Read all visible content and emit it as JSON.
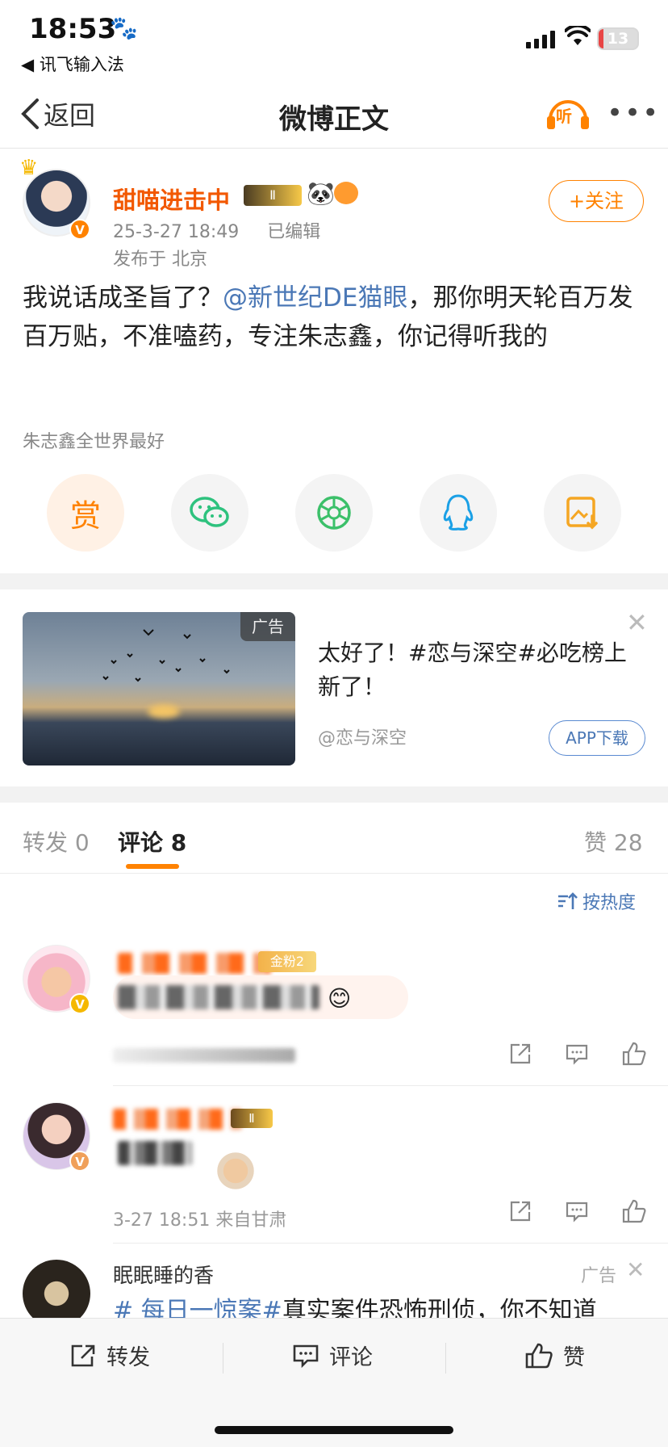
{
  "status_bar": {
    "time": "18:53",
    "back_app": "◀ 讯飞输入法",
    "battery_level": "13"
  },
  "nav": {
    "back_label": "返回",
    "title": "微博正文",
    "listen_label": "听"
  },
  "post": {
    "username": "甜喵进击中",
    "level_badge": "Ⅱ",
    "datetime": "25-3-27 18:49",
    "edited": "已编辑",
    "location": "发布于 北京",
    "follow_label": "+关注",
    "content_prefix": "我说话成圣旨了？",
    "mention": "@新世纪DE猫眼",
    "content_suffix": "，那你明天轮百万发百万贴，不准嗑药，专注朱志鑫，你记得听我的",
    "topic": "朱志鑫全世界最好",
    "share_buttons": [
      {
        "name": "reward",
        "label": "赏"
      },
      {
        "name": "wechat",
        "label": ""
      },
      {
        "name": "moments",
        "label": ""
      },
      {
        "name": "qq",
        "label": ""
      },
      {
        "name": "save-image",
        "label": ""
      }
    ]
  },
  "ad": {
    "badge": "广告",
    "text": "太好了！#恋与深空#必吃榜上新了！",
    "source": "@恋与深空",
    "button": "APP下载"
  },
  "tabs": {
    "repost": "转发 0",
    "comment": "评论 8",
    "like": "赞 28",
    "sort": "按热度"
  },
  "comments": [
    {
      "fan_badge": "金粉2",
      "time_location": ""
    },
    {
      "fan_badge": "Ⅱ",
      "time_location": "3-27 18:51 来自甘肃"
    }
  ],
  "ad2": {
    "name": "眠眠睡的香",
    "tag": "广告",
    "hashtag": "# 每日一惊案#",
    "text": "真实案件恐怖刑侦，你不知道"
  },
  "bottom_bar": {
    "repost": "转发",
    "comment": "评论",
    "like": "赞"
  },
  "colors": {
    "brand_orange": "#ff8200",
    "link_blue": "#4b78b6"
  }
}
